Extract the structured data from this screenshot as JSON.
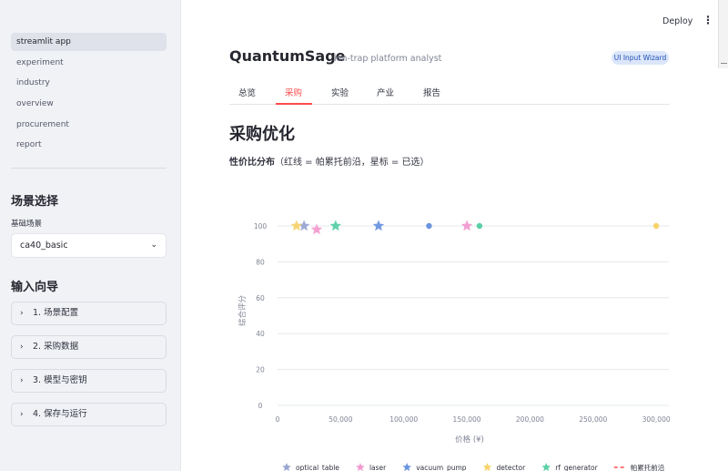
{
  "sidebar": {
    "nav": [
      "streamlit app",
      "experiment",
      "industry",
      "overview",
      "procurement",
      "report"
    ],
    "scenario_header": "场景选择",
    "scenario_label": "基础场景",
    "scenario_value": "ca40_basic",
    "wizard_header": "输入向导",
    "expanders": [
      "1. 场景配置",
      "2. 采购数据",
      "3. 模型与密钥",
      "4. 保存与运行"
    ]
  },
  "topbar": {
    "deploy": "Deploy",
    "menu": "⋮"
  },
  "main": {
    "title": "QuantumSage",
    "subtitle": "ion-trap platform analyst",
    "badge": "UI Input Wizard",
    "tabs": [
      "总览",
      "采购",
      "实验",
      "产业",
      "报告"
    ],
    "heading": "采购优化",
    "chart_caption_bold": "性价比分布",
    "chart_caption_rest": "（红线 = 帕累托前沿，星标 = 已选）"
  },
  "colors": {
    "optical_table": "#9aa6d3",
    "laser": "#f29bd0",
    "vacuum_pump": "#6b95e0",
    "detector": "#f7d36b",
    "rf_generator": "#5bd0a5",
    "pareto": "#ff4b4b",
    "accent": "#ff4b4b"
  },
  "chart_data": {
    "type": "scatter",
    "xlabel": "价格 (¥)",
    "ylabel": "综合评分",
    "xlim": [
      0,
      310000
    ],
    "ylim": [
      0,
      100
    ],
    "x_ticks": [
      0,
      50000,
      100000,
      150000,
      200000,
      250000,
      300000
    ],
    "x_tick_labels": [
      "0",
      "50,000",
      "100,000",
      "150,000",
      "200,000",
      "250,000",
      "300,000"
    ],
    "y_ticks": [
      0,
      20,
      40,
      60,
      80,
      100
    ],
    "y_tick_labels": [
      "0",
      "20",
      "40",
      "60",
      "80",
      "100"
    ],
    "grid": true,
    "legend_position": "bottom",
    "series": [
      {
        "name": "optical_table",
        "color": "optical_table",
        "points": [
          {
            "x": 21000,
            "y": 100,
            "marker": "star"
          }
        ]
      },
      {
        "name": "laser",
        "color": "laser",
        "points": [
          {
            "x": 31000,
            "y": 98,
            "marker": "star"
          },
          {
            "x": 150000,
            "y": 100,
            "marker": "star"
          }
        ]
      },
      {
        "name": "vacuum_pump",
        "color": "vacuum_pump",
        "points": [
          {
            "x": 80000,
            "y": 100,
            "marker": "star"
          },
          {
            "x": 120000,
            "y": 100,
            "marker": "circle"
          }
        ]
      },
      {
        "name": "detector",
        "color": "detector",
        "points": [
          {
            "x": 15000,
            "y": 100,
            "marker": "star"
          },
          {
            "x": 300000,
            "y": 100,
            "marker": "circle"
          }
        ]
      },
      {
        "name": "rf_generator",
        "color": "rf_generator",
        "points": [
          {
            "x": 46000,
            "y": 100,
            "marker": "star"
          },
          {
            "x": 160000,
            "y": 100,
            "marker": "circle"
          }
        ]
      },
      {
        "name": "帕累托前沿",
        "color": "pareto",
        "type": "line",
        "points": []
      }
    ]
  }
}
